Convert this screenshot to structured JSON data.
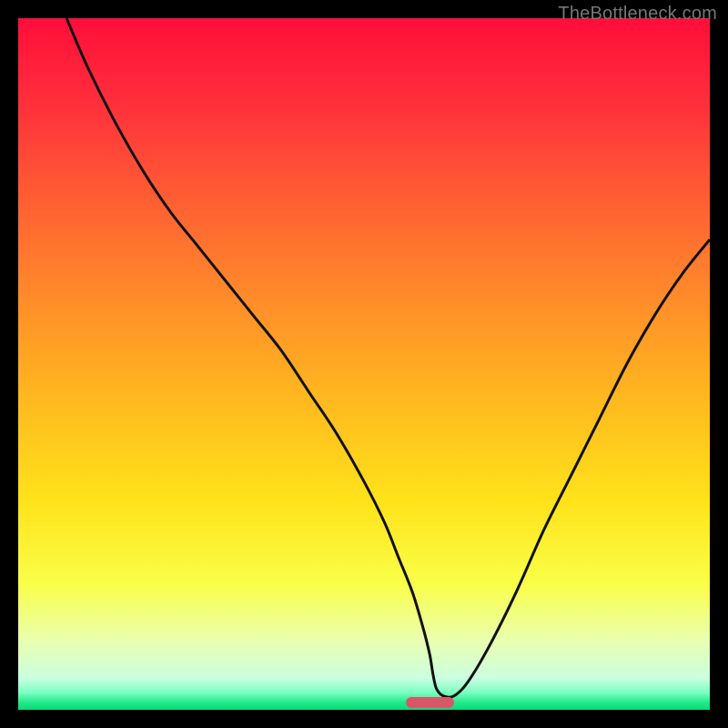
{
  "watermark": "TheBottleneck.com",
  "chart_data": {
    "type": "line",
    "title": "",
    "xlabel": "",
    "ylabel": "",
    "xlim": [
      0,
      100
    ],
    "ylim": [
      0,
      100
    ],
    "background_gradient": {
      "stops": [
        {
          "offset": 0.0,
          "color": "#ff0e3a"
        },
        {
          "offset": 0.12,
          "color": "#ff2e3c"
        },
        {
          "offset": 0.25,
          "color": "#ff5a34"
        },
        {
          "offset": 0.4,
          "color": "#ff8a2a"
        },
        {
          "offset": 0.55,
          "color": "#ffb81f"
        },
        {
          "offset": 0.7,
          "color": "#ffe31a"
        },
        {
          "offset": 0.82,
          "color": "#f9ff4a"
        },
        {
          "offset": 0.9,
          "color": "#eaffb0"
        },
        {
          "offset": 0.955,
          "color": "#c9ffe0"
        },
        {
          "offset": 0.975,
          "color": "#7affc0"
        },
        {
          "offset": 0.99,
          "color": "#1fe88a"
        },
        {
          "offset": 1.0,
          "color": "#0fd878"
        }
      ]
    },
    "series": [
      {
        "name": "bottleneck-curve",
        "color": "#111111",
        "stroke_width": 3,
        "x": [
          7,
          10,
          14,
          18,
          22,
          26,
          30,
          34,
          38,
          42,
          46,
          50,
          53,
          55,
          57,
          58.5,
          59.5,
          60,
          60.5,
          61.5,
          63,
          65,
          68,
          72,
          76,
          80,
          84,
          88,
          92,
          96,
          100
        ],
        "y": [
          100,
          93,
          85,
          78,
          72,
          67,
          62,
          57,
          52,
          46,
          40,
          33,
          27,
          22,
          17,
          12,
          8,
          5,
          3,
          2,
          2,
          4,
          9,
          17,
          26,
          34,
          42,
          50,
          57,
          63,
          68
        ]
      }
    ],
    "marker": {
      "name": "optimal-range",
      "color": "#d9566a",
      "x_start": 56,
      "x_end": 63,
      "y": 1
    }
  }
}
